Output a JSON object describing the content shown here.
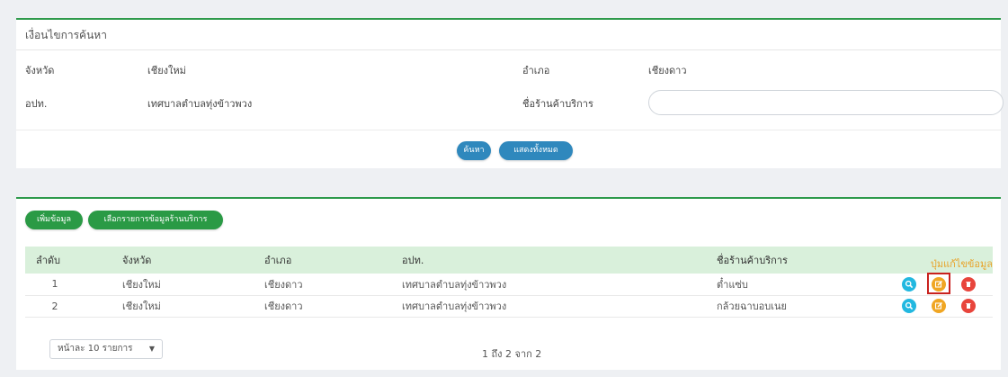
{
  "search": {
    "title": "เงื่อนไขการค้นหา",
    "province_label": "จังหวัด",
    "province_value": "เชียงใหม่",
    "district_label": "อำเภอ",
    "district_value": "เชียงดาว",
    "local_org_label": "อปท.",
    "local_org_value": "เทศบาลตำบลทุ่งข้าวพวง",
    "shop_name_label": "ชื่อร้านค้าบริการ",
    "shop_name_value": "",
    "search_button": "ค้นหา",
    "show_all_button": "แสดงทั้งหมด"
  },
  "results": {
    "add_button": "เพิ่มข้อมูล",
    "select_list_button": "เลือกรายการข้อมูลร้านบริการ",
    "annotation": "ปุ่มแก้ไขข้อมูล",
    "columns": [
      "ลำดับ",
      "จังหวัด",
      "อำเภอ",
      "อปท.",
      "ชื่อร้านค้าบริการ",
      ""
    ],
    "rows": [
      {
        "no": "1",
        "province": "เชียงใหม่",
        "district": "เชียงดาว",
        "org": "เทศบาลตำบลทุ่งข้าวพวง",
        "shop": "ต๋ำแซ่บ"
      },
      {
        "no": "2",
        "province": "เชียงใหม่",
        "district": "เชียงดาว",
        "org": "เทศบาลตำบลทุ่งข้าวพวง",
        "shop": "กล้วยฉาบอบเนย"
      }
    ],
    "page_size_label": "หน้าละ 10 รายการ",
    "pager_text": "1 ถึง 2 จาก 2"
  },
  "icons": {
    "view": "search-icon",
    "edit": "edit-icon",
    "delete": "trash-icon"
  },
  "colors": {
    "accent_green": "#2a9a45",
    "button_blue": "#2f88bd",
    "header_green": "#d9f0db",
    "view_blue": "#22b8e0",
    "edit_orange": "#f0a623",
    "delete_red": "#e8453c",
    "highlight_red": "#c9221e",
    "annotation_orange": "#e8a32a"
  }
}
